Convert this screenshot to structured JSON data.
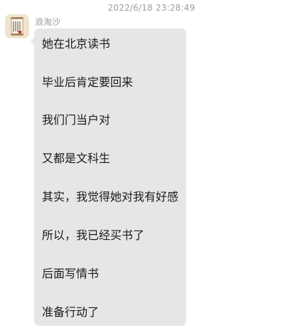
{
  "chat": {
    "timestamp": "2022/6/18 23:28:49",
    "sender_name": "浪淘沙",
    "avatar_icon": "scroll-document-icon",
    "bubble_color": "#e6e6e6",
    "message_lines": [
      "她在北京读书",
      "毕业后肯定要回来",
      "我们门当户对",
      "又都是文科生",
      "其实，我觉得她对我有好感",
      "所以，我已经买书了",
      "后面写情书",
      "准备行动了"
    ]
  }
}
